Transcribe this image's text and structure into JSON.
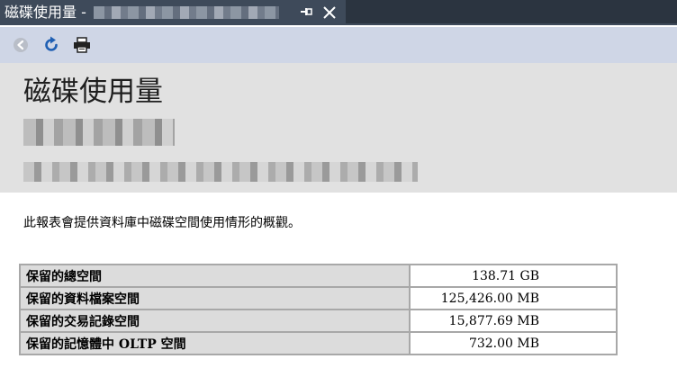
{
  "tab": {
    "title": "磁碟使用量 -",
    "pin_glyph": "⊣",
    "close_label": "×"
  },
  "toolbar": {
    "back_icon": "back-arrow-icon",
    "refresh_icon": "refresh-icon",
    "print_icon": "printer-icon"
  },
  "report": {
    "title": "磁碟使用量",
    "description": "此報表會提供資料庫中磁碟空間使用情形的概觀。"
  },
  "table": {
    "rows": [
      {
        "label": "保留的總空間",
        "value": "138.71 GB"
      },
      {
        "label": "保留的資料檔案空間",
        "value": "125,426.00 MB"
      },
      {
        "label": "保留的交易記錄空間",
        "value": "15,877.69 MB"
      },
      {
        "label": "保留的記憶體中 OLTP 空間",
        "value": "732.00 MB"
      }
    ]
  },
  "colors": {
    "tabbar": "#2b3440",
    "tab_active": "#3e4a5a",
    "toolbar": "#cfd6e6",
    "header": "#e1e1e1",
    "refresh_blue": "#1f5fb3",
    "label_cell": "#dcdcdc"
  }
}
